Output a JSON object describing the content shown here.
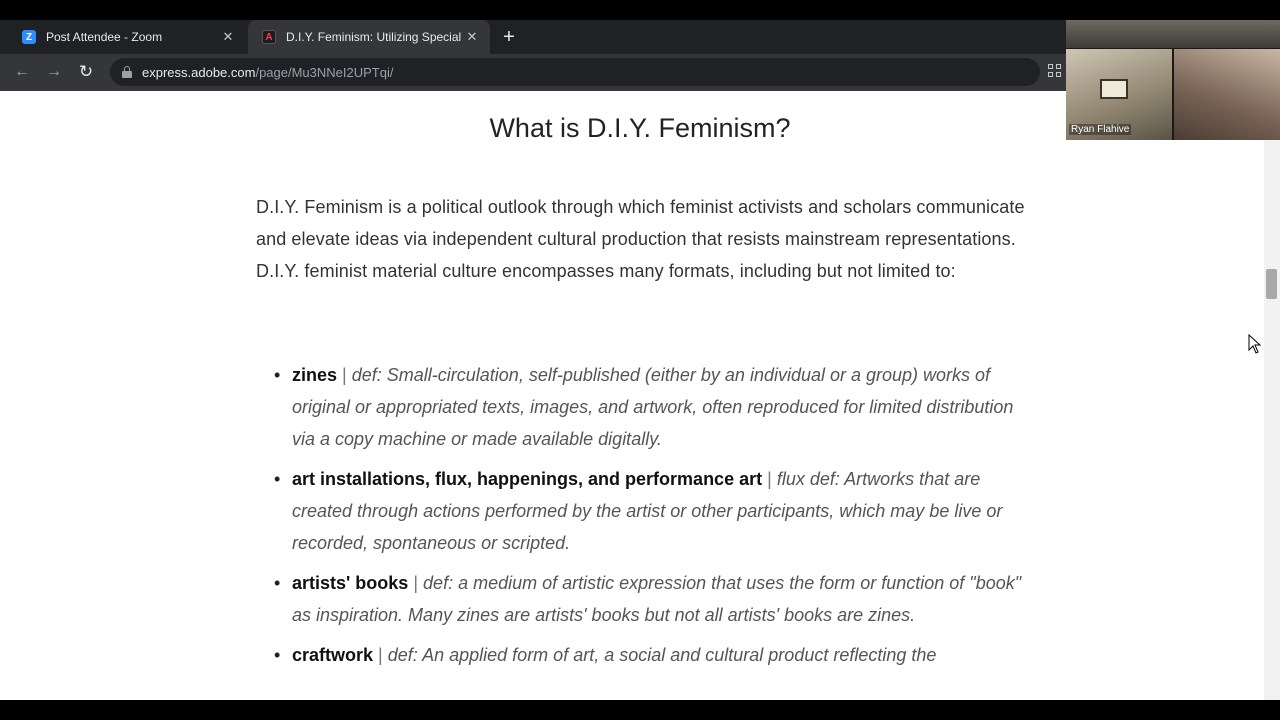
{
  "browser": {
    "tabs": [
      {
        "title": "Post Attendee - Zoom",
        "icon": "zoom-icon",
        "active": false
      },
      {
        "title": "D.I.Y. Feminism: Utilizing Special",
        "icon": "adobe-icon",
        "active": true
      }
    ],
    "address": {
      "domain": "express.adobe.com",
      "path": "/page/Mu3NNeI2UPTqi/"
    }
  },
  "video": {
    "participant_name": "Ryan Flahive"
  },
  "page": {
    "heading": "What is D.I.Y. Feminism?",
    "intro": "D.I.Y. Feminism is a political outlook through which feminist activists and scholars communicate and elevate ideas via independent cultural production that resists mainstream representations. D.I.Y. feminist material culture encompasses many formats, including but not limited to:",
    "items": [
      {
        "term": "zines",
        "separator": "|",
        "definition": "def: Small-circulation, self-published (either by an individual or a group) works of original or appropriated texts, images, and artwork, often reproduced for limited distribution via a copy machine or made available digitally."
      },
      {
        "term": "art installations, flux, happenings, and performance art",
        "separator": "|",
        "definition": "flux def: Artworks that are created through actions performed by the artist or other participants, which may be live or recorded, spontaneous or scripted."
      },
      {
        "term": "artists' books",
        "separator": "|",
        "definition": "def: a medium of artistic expression that uses the form or function of \"book\" as inspiration. Many zines are artists' books but not all artists' books are zines."
      },
      {
        "term": "craftwork",
        "separator": "|",
        "definition": "def: An applied form of art, a social and cultural product reflecting the"
      }
    ]
  },
  "colors": {
    "tab_strip": "#202124",
    "toolbar": "#35363a",
    "page_background": "#ffffff",
    "text": "#333333"
  }
}
